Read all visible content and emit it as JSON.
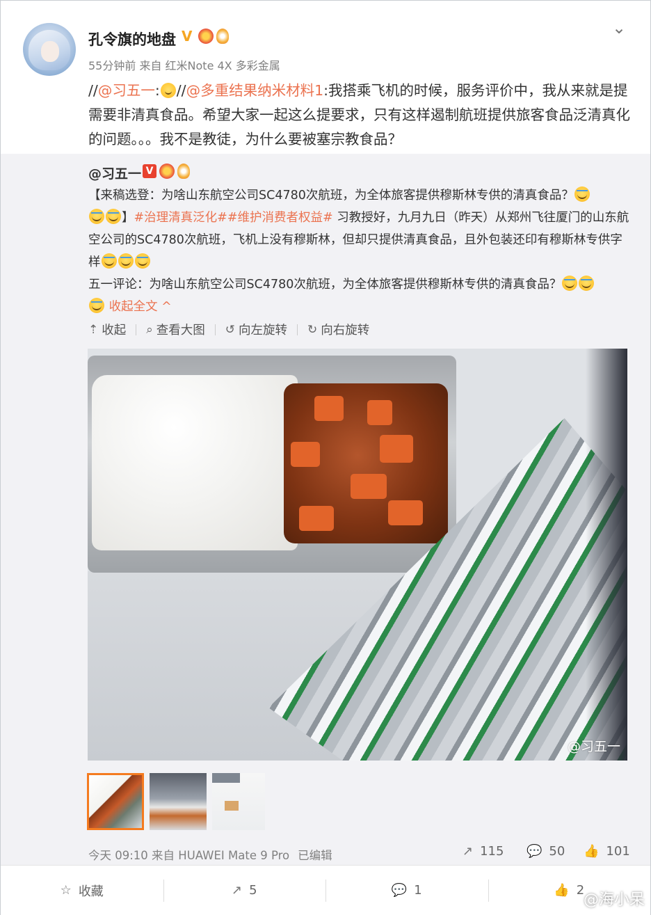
{
  "post": {
    "username": "孔令旗的地盘",
    "meta": "55分钟前 来自 红米Note 4X 多彩金属",
    "text_prefix": "//",
    "mention1": "@习五一",
    "colon1": ":",
    "mid_sep": "//",
    "mention2": "@多重结果纳米材料1",
    "text_body": ":我搭乘飞机的时候，服务评价中，我从来就是提需要非清真食品。希望大家一起这么提要求，只有这样遏制航班提供旅客食品泛清真化的问题。。。我不是教徒，为什么要被塞宗教食品？"
  },
  "repost": {
    "username": "@习五一",
    "text_a": "【来稿选登：为啥山东航空公司SC4780次航班，为全体旅客提供穆斯林专供的清真食品？",
    "text_b": "】",
    "topic1": "#治理清真泛化#",
    "topic2": "#维护消费者权益#",
    "text_c": " 习教授好，九月九日（昨天）从郑州飞往厦门的山东航空公司的SC4780次航班，飞机上没有穆斯林，但却只提供清真食品，且外包装还印有穆斯林专供字样",
    "text_d": "五一评论：为啥山东航空公司SC4780次航班，为全体旅客提供穆斯林专供的清真食品？",
    "collapse": "收起全文 ^",
    "toolbar": {
      "collapse": "收起",
      "view_large": "查看大图",
      "rotate_left": "向左旋转",
      "rotate_right": "向右旋转"
    },
    "photo_watermark": "@习五一",
    "time": "今天 09:10 来自 HUAWEI Mate 9 Pro",
    "edited": "已编辑",
    "reposts": "115",
    "comments": "50",
    "likes": "101"
  },
  "bottom": {
    "favorite": "收藏",
    "repost": "5",
    "comment": "1",
    "like": "2",
    "watermark": "@海小呆"
  },
  "icons": {
    "chevron": "chevron-down-icon",
    "repost": "repost-icon",
    "comment": "comment-icon",
    "like": "thumbs-up-icon",
    "star": "star-icon"
  },
  "colors": {
    "accent": "#eb7350",
    "verified": "#f5a623",
    "thumb_selected": "#f47b20"
  }
}
